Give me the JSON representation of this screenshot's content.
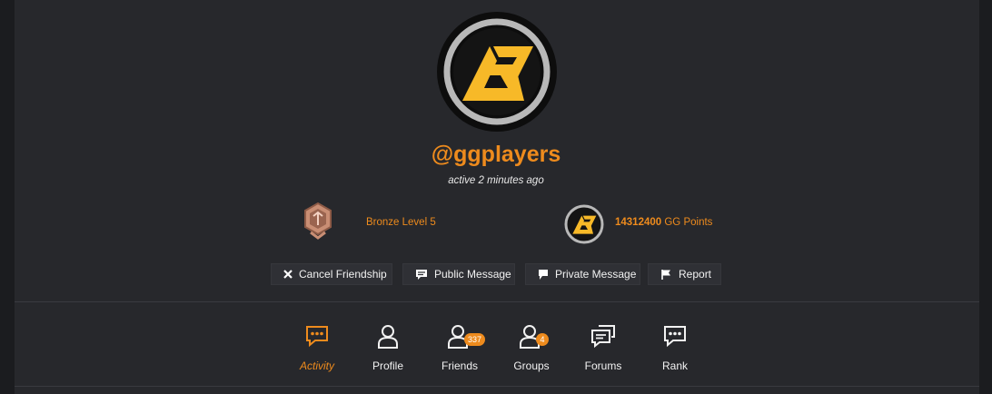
{
  "profile": {
    "username": "@ggplayers",
    "last_active": "active 2 minutes ago",
    "logo_text": "GG"
  },
  "stats": {
    "level": "Bronze Level 5",
    "points_value": "14312400",
    "points_label": " GG Points"
  },
  "actions": {
    "cancel_friendship": "Cancel Friendship",
    "public_message": "Public Message",
    "private_message": "Private Message",
    "report": "Report"
  },
  "tabs": [
    {
      "label": "Activity",
      "icon": "activity-bubble-icon",
      "active": true
    },
    {
      "label": "Profile",
      "icon": "user-icon"
    },
    {
      "label": "Friends",
      "icon": "friends-icon",
      "count": "337"
    },
    {
      "label": "Groups",
      "icon": "groups-icon",
      "count": "4"
    },
    {
      "label": "Forums",
      "icon": "forums-icon"
    },
    {
      "label": "Rank",
      "icon": "rank-icon"
    }
  ],
  "colors": {
    "accent": "#ee8b1d",
    "background": "#27282c",
    "text": "#f2f2f2",
    "logo_yellow": "#f7b928"
  }
}
